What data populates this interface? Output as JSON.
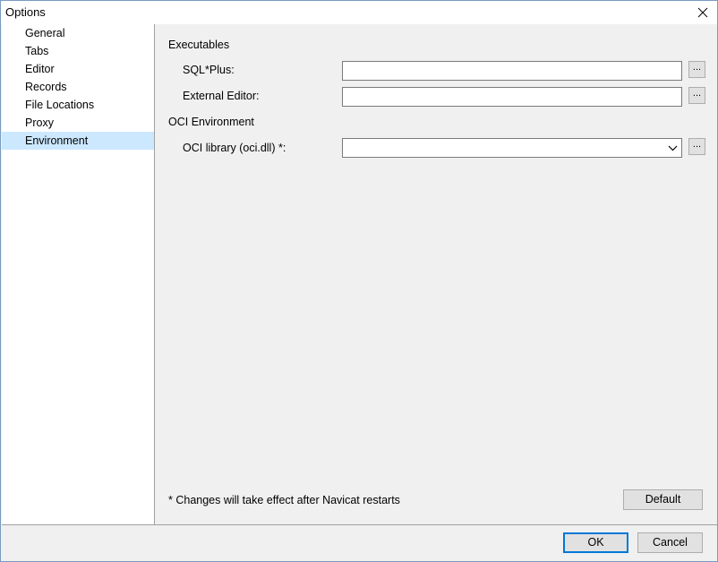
{
  "window": {
    "title": "Options"
  },
  "sidebar": {
    "items": [
      {
        "label": "General"
      },
      {
        "label": "Tabs"
      },
      {
        "label": "Editor"
      },
      {
        "label": "Records"
      },
      {
        "label": "File Locations"
      },
      {
        "label": "Proxy"
      },
      {
        "label": "Environment"
      }
    ],
    "selected": "Environment"
  },
  "content": {
    "executables": {
      "heading": "Executables",
      "sqlplus_label": "SQL*Plus:",
      "sqlplus_value": "",
      "external_editor_label": "External Editor:",
      "external_editor_value": ""
    },
    "oci": {
      "heading": "OCI Environment",
      "library_label": "OCI library (oci.dll) *:",
      "library_value": ""
    },
    "browse_label": "...",
    "note": "* Changes will take effect after Navicat restarts",
    "default_label": "Default"
  },
  "footer": {
    "ok_label": "OK",
    "cancel_label": "Cancel"
  },
  "colors": {
    "selection": "#cce8ff",
    "focus_border": "#0078d7"
  }
}
